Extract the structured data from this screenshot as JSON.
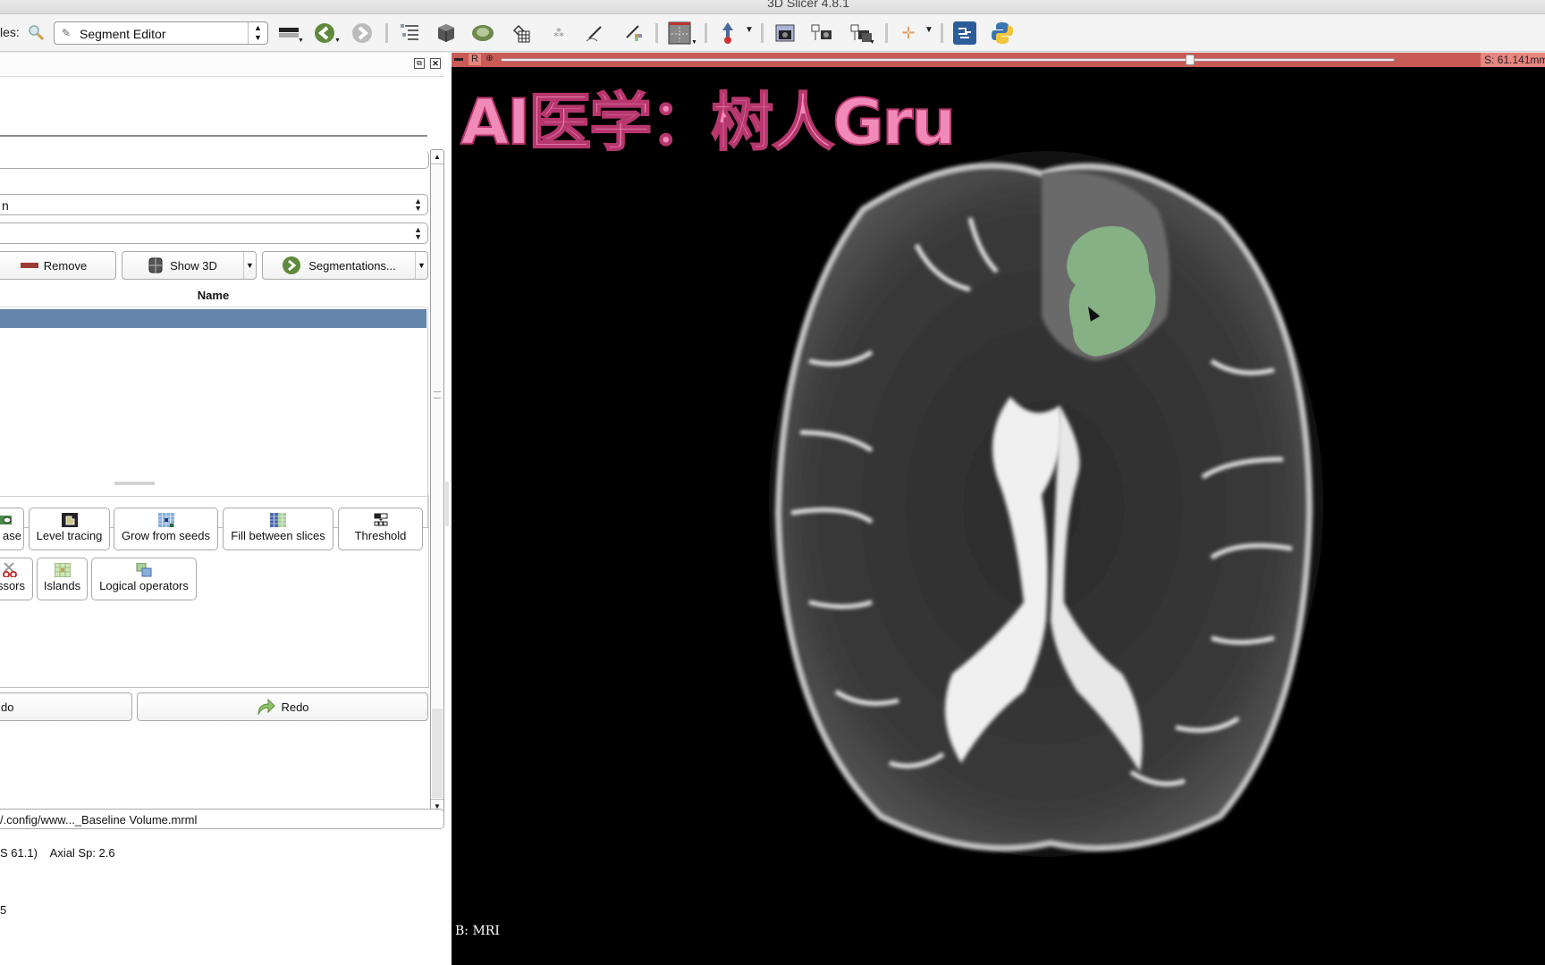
{
  "window": {
    "title": "3D Slicer 4.8.1"
  },
  "toolbar": {
    "modules_label": "les:",
    "module_selector": "Segment Editor",
    "icons": [
      "search-icon",
      "module-history-icon",
      "back-icon",
      "forward-icon",
      "data-icon",
      "volumes-icon",
      "models-icon",
      "transforms-icon",
      "markups-icon",
      "editor-icon",
      "segment-editor-icon",
      "layout-icon",
      "crosshair-fiducial-icon",
      "screenshot-icon",
      "scene-view-icon",
      "scene-views-manager-icon",
      "crosshair-icon",
      "extension-manager-icon",
      "python-icon"
    ]
  },
  "left_panel": {
    "segmentation_combo": "n",
    "master_volume_combo": "",
    "buttons": {
      "remove": "Remove",
      "show3d": "Show 3D",
      "segmentations": "Segmentations..."
    },
    "table": {
      "columns": [
        "Name"
      ],
      "rows": [
        {
          "name": "",
          "selected": true
        }
      ]
    },
    "effects": {
      "row1": [
        "ase",
        "Level tracing",
        "Grow from seeds",
        "Fill between slices",
        "Threshold"
      ],
      "row2": [
        "ssors",
        "Islands",
        "Logical operators"
      ]
    },
    "undo_label": "do",
    "redo_label": "Redo",
    "scene_path": "/.config/www..._Baseline Volume.mrml",
    "status_line": "S 61.1)    Axial Sp: 2.6",
    "status_line2": "5"
  },
  "viewer": {
    "slice_controller": {
      "view_letter": "R",
      "offset_label": "S: 61.141mm",
      "slider_position": 0.77
    },
    "overlay_watermark": "AI医学：树人Gru",
    "view_label": "B: MRI",
    "segment_color": "#8fc98f"
  }
}
